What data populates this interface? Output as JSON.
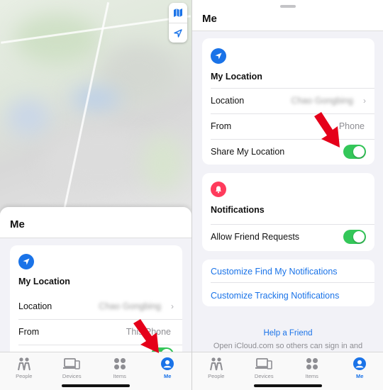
{
  "left": {
    "sheet_title": "Me",
    "my_location_heading": "My Location",
    "location_label": "Location",
    "location_value": "Chao Gongbing",
    "from_label": "From",
    "from_value": "This Phone"
  },
  "right": {
    "sheet_title": "Me",
    "my_location_heading": "My Location",
    "location_label": "Location",
    "location_value": "Chao Gongbing",
    "from_label": "From",
    "from_value": "Phone",
    "share_label": "Share My Location",
    "share_enabled": true,
    "notifications_heading": "Notifications",
    "friend_requests_label": "Allow Friend Requests",
    "friend_requests_enabled": true,
    "links": [
      "Customize Find My Notifications",
      "Customize Tracking Notifications"
    ],
    "help_link": "Help a Friend",
    "help_text": "Open iCloud.com so others can sign in and"
  },
  "tabs": [
    {
      "label": "People",
      "icon": "people-icon"
    },
    {
      "label": "Devices",
      "icon": "devices-icon"
    },
    {
      "label": "Items",
      "icon": "items-icon"
    },
    {
      "label": "Me",
      "icon": "me-icon"
    }
  ],
  "active_tab": "Me",
  "colors": {
    "accent": "#1a73e8",
    "toggle_on": "#34c759",
    "notification_icon": "#ff3b5c",
    "arrow": "#e5001a"
  }
}
